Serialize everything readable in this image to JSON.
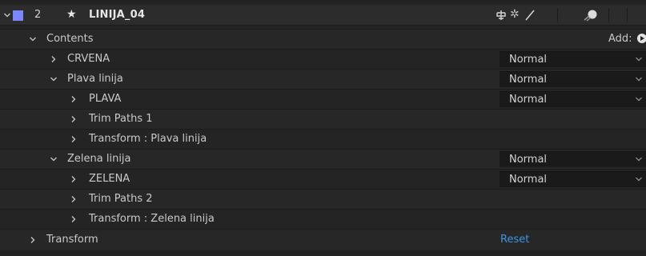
{
  "layer": {
    "number": "2",
    "name": "LINIJA_04",
    "label_color": "#7a87ff"
  },
  "contents": {
    "label": "Contents",
    "add_label": "Add:"
  },
  "rows": [
    {
      "name": "CRVENA",
      "blend": "Normal"
    },
    {
      "name": "Plava linija",
      "blend": "Normal"
    },
    {
      "name": "PLAVA",
      "blend": "Normal"
    },
    {
      "name": "Trim Paths 1"
    },
    {
      "name": "Transform : Plava linija"
    },
    {
      "name": "Zelena linija",
      "blend": "Normal"
    },
    {
      "name": "ZELENA",
      "blend": "Normal"
    },
    {
      "name": "Trim Paths 2"
    },
    {
      "name": "Transform : Zelena linija"
    }
  ],
  "transform": {
    "label": "Transform",
    "reset_label": "Reset"
  },
  "colors": {
    "accent_link": "#3d95e6",
    "panel_bg": "#232323"
  }
}
